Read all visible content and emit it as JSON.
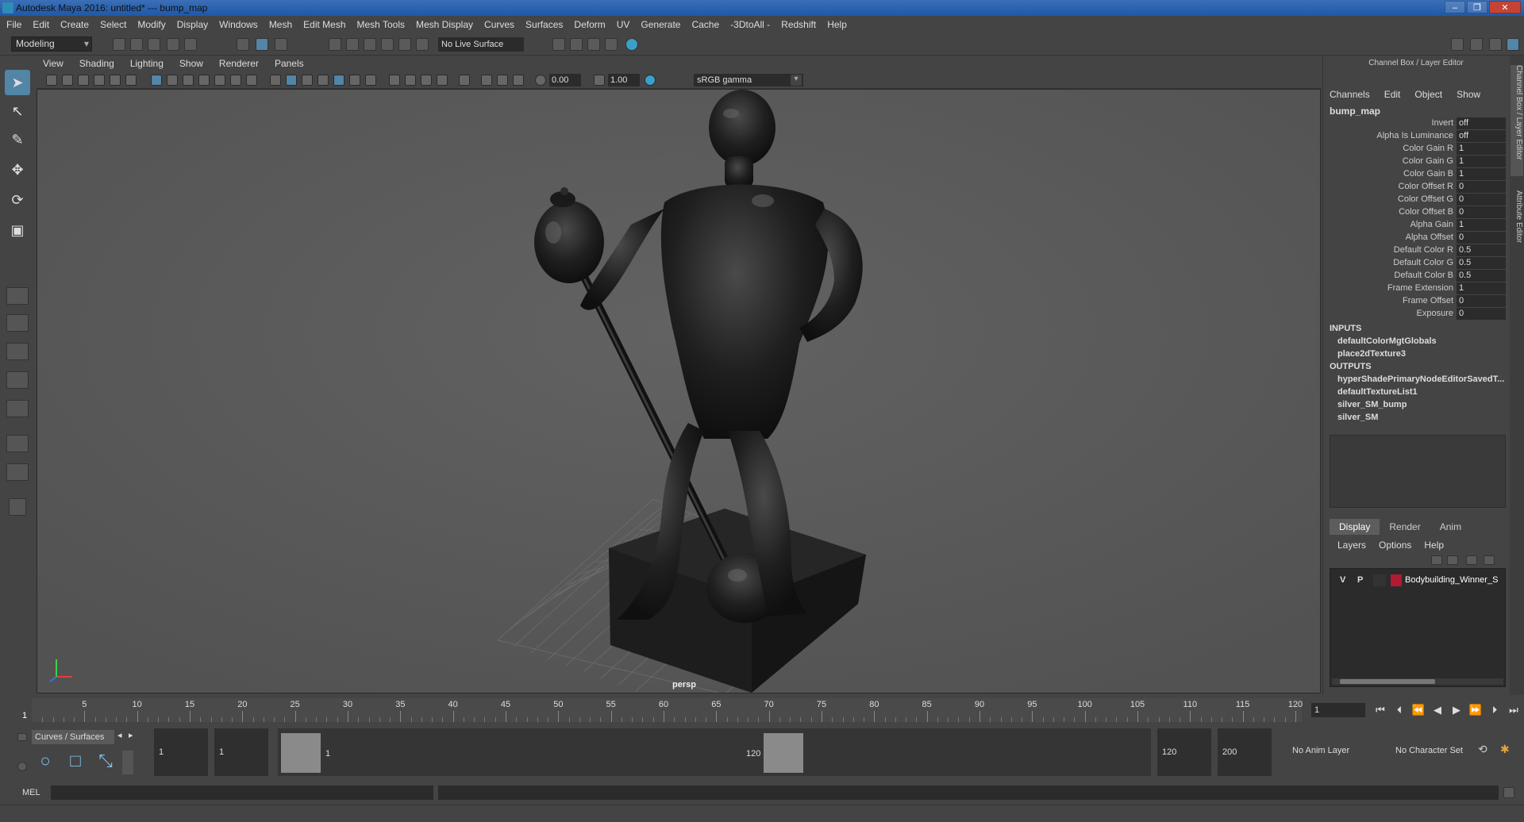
{
  "window": {
    "title": "Autodesk Maya 2016: untitled*   ---   bump_map",
    "minimize": "–",
    "restore": "❐",
    "close": "✕"
  },
  "menu": [
    "File",
    "Edit",
    "Create",
    "Select",
    "Modify",
    "Display",
    "Windows",
    "Mesh",
    "Edit Mesh",
    "Mesh Tools",
    "Mesh Display",
    "Curves",
    "Surfaces",
    "Deform",
    "UV",
    "Generate",
    "Cache",
    "-3DtoAll -",
    "Redshift",
    "Help"
  ],
  "shelf": {
    "mode": "Modeling",
    "live_surface": "No Live Surface"
  },
  "viewport": {
    "menu": [
      "View",
      "Shading",
      "Lighting",
      "Show",
      "Renderer",
      "Panels"
    ],
    "exposure": "0.00",
    "gamma": "1.00",
    "color_space": "sRGB gamma",
    "camera": "persp"
  },
  "channel_box": {
    "header": "Channel Box / Layer Editor",
    "menu": [
      "Channels",
      "Edit",
      "Object",
      "Show"
    ],
    "node": "bump_map",
    "attributes": [
      {
        "label": "Invert",
        "value": "off"
      },
      {
        "label": "Alpha Is Luminance",
        "value": "off"
      },
      {
        "label": "Color Gain R",
        "value": "1"
      },
      {
        "label": "Color Gain G",
        "value": "1"
      },
      {
        "label": "Color Gain B",
        "value": "1"
      },
      {
        "label": "Color Offset R",
        "value": "0"
      },
      {
        "label": "Color Offset G",
        "value": "0"
      },
      {
        "label": "Color Offset B",
        "value": "0"
      },
      {
        "label": "Alpha Gain",
        "value": "1"
      },
      {
        "label": "Alpha Offset",
        "value": "0"
      },
      {
        "label": "Default Color R",
        "value": "0.5"
      },
      {
        "label": "Default Color G",
        "value": "0.5"
      },
      {
        "label": "Default Color B",
        "value": "0.5"
      },
      {
        "label": "Frame Extension",
        "value": "1"
      },
      {
        "label": "Frame Offset",
        "value": "0"
      },
      {
        "label": "Exposure",
        "value": "0"
      }
    ],
    "inputs_label": "INPUTS",
    "inputs": [
      "defaultColorMgtGlobals",
      "place2dTexture3"
    ],
    "outputs_label": "OUTPUTS",
    "outputs": [
      "hyperShadePrimaryNodeEditorSavedT...",
      "defaultTextureList1",
      "silver_SM_bump",
      "silver_SM"
    ]
  },
  "layers": {
    "tabs": [
      "Display",
      "Render",
      "Anim"
    ],
    "active_tab": "Display",
    "menu": [
      "Layers",
      "Options",
      "Help"
    ],
    "row": {
      "v": "V",
      "p": "P",
      "name": "Bodybuilding_Winner_S",
      "color": "#b01a33"
    }
  },
  "side_tabs": [
    "Channel Box / Layer Editor",
    "Attribute Editor"
  ],
  "timeline": {
    "ticks": [
      "5",
      "10",
      "15",
      "20",
      "25",
      "30",
      "35",
      "40",
      "45",
      "50",
      "55",
      "60",
      "65",
      "70",
      "75",
      "80",
      "85",
      "90",
      "95",
      "100",
      "105",
      "110",
      "115",
      "120"
    ],
    "current_frame": "1",
    "current_field": "1"
  },
  "range": {
    "shelf_tab": "Curves / Surfaces",
    "start": "1",
    "playback_start": "1",
    "slider_start": "1",
    "slider_end": "120",
    "playback_end": "120",
    "end": "200",
    "anim_layer": "No Anim Layer",
    "character_set": "No Character Set"
  },
  "command_line": {
    "label": "MEL"
  }
}
